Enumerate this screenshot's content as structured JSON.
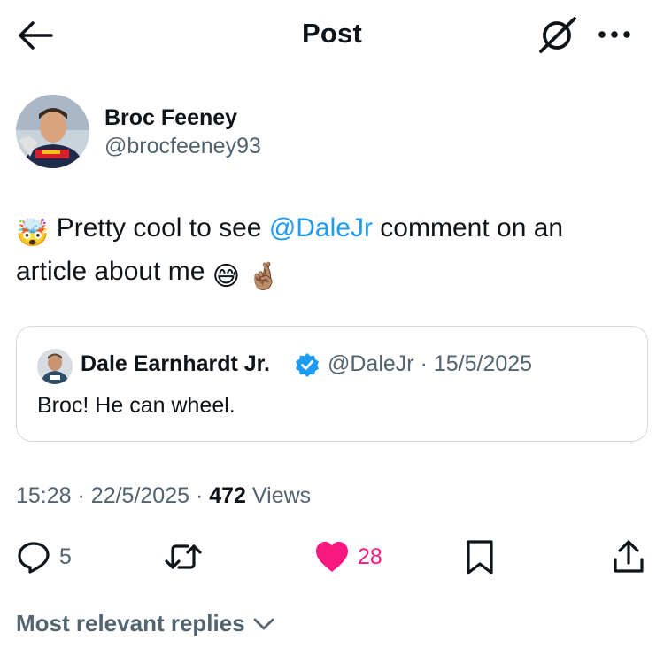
{
  "header": {
    "title": "Post",
    "back_icon": "arrow-left-icon",
    "grok_icon": "grok-icon",
    "more_icon": "more-dots-icon"
  },
  "author": {
    "name": "Broc Feeney",
    "handle": "@brocfeeney93"
  },
  "post": {
    "emoji_lead": "🤯",
    "text_before": " Pretty cool to see ",
    "mention": "@DaleJr",
    "text_after": " comment on an article about me ",
    "emoji_trailing": [
      "😅",
      "🤞🏽"
    ]
  },
  "quote": {
    "name": "Dale Earnhardt Jr.",
    "handle": "@DaleJr",
    "separator": "·",
    "date": "15/5/2025",
    "text": "Broc! He can wheel."
  },
  "meta": {
    "time": "15:28",
    "separator": "·",
    "date": "22/5/2025",
    "views_count": "472",
    "views_label": "Views"
  },
  "actions": {
    "replies": "5",
    "reposts": "",
    "likes": "28",
    "like_color": "#f91880"
  },
  "replies_sort": {
    "label": "Most relevant replies"
  },
  "colors": {
    "accent": "#1d9bf0",
    "text": "#0f1419",
    "secondary": "#536471",
    "border": "#cfd9de"
  }
}
